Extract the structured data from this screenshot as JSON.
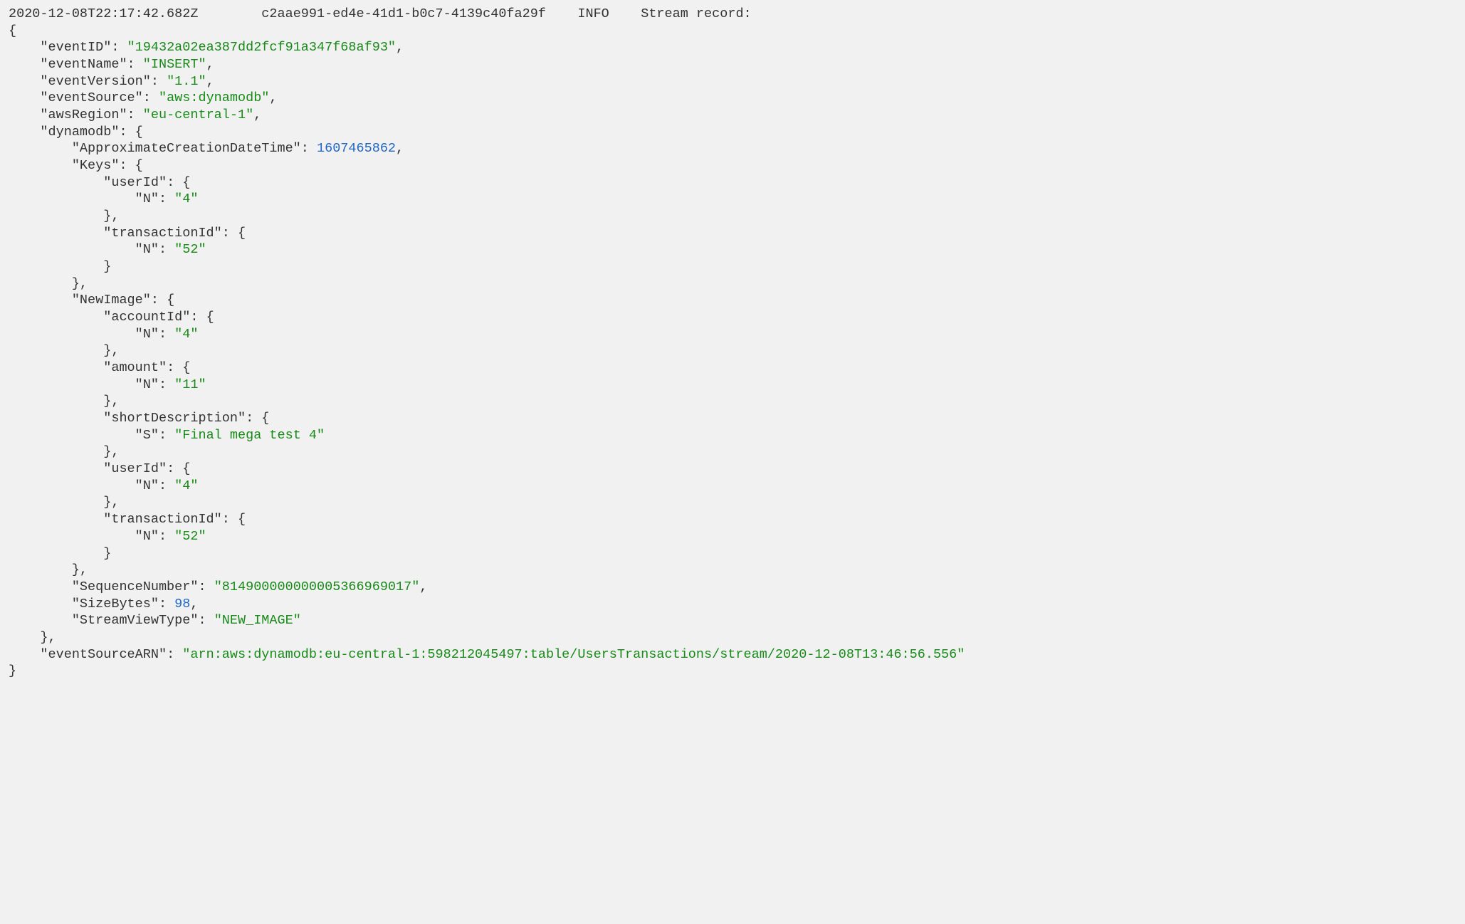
{
  "header": {
    "timestamp": "2020-12-08T22:17:42.682Z",
    "request_id": "c2aae991-ed4e-41d1-b0c7-4139c40fa29f",
    "level": "INFO",
    "message": "Stream record:"
  },
  "indent": "    ",
  "record": {
    "eventID": "19432a02ea387dd2fcf91a347f68af93",
    "eventName": "INSERT",
    "eventVersion": "1.1",
    "eventSource": "aws:dynamodb",
    "awsRegion": "eu-central-1",
    "dynamodb": {
      "ApproximateCreationDateTime": 1607465862,
      "Keys": {
        "userId": {
          "N": "4"
        },
        "transactionId": {
          "N": "52"
        }
      },
      "NewImage": {
        "accountId": {
          "N": "4"
        },
        "amount": {
          "N": "11"
        },
        "shortDescription": {
          "S": "Final mega test 4"
        },
        "userId": {
          "N": "4"
        },
        "transactionId": {
          "N": "52"
        }
      },
      "SequenceNumber": "814900000000005366969017",
      "SizeBytes": 98,
      "StreamViewType": "NEW_IMAGE"
    },
    "eventSourceARN": "arn:aws:dynamodb:eu-central-1:598212045497:table/UsersTransactions/stream/2020-12-08T13:46:56.556"
  }
}
